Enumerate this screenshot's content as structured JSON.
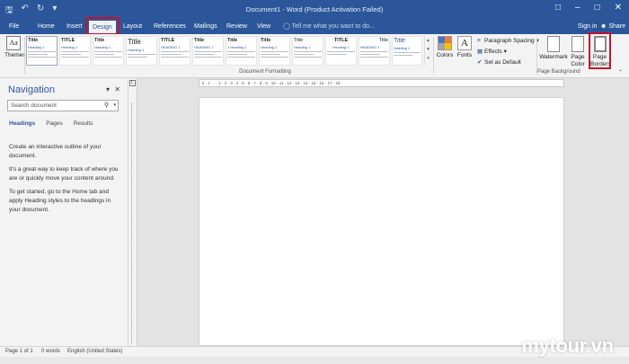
{
  "window": {
    "title": "Document1 - Word (Product Activation Failed)"
  },
  "quick_access": [
    "save-icon",
    "undo-icon",
    "redo-icon",
    "customize-icon"
  ],
  "tabs": [
    {
      "label": "File"
    },
    {
      "label": "Home"
    },
    {
      "label": "Insert"
    },
    {
      "label": "Design",
      "active": true
    },
    {
      "label": "Layout"
    },
    {
      "label": "References"
    },
    {
      "label": "Mailings"
    },
    {
      "label": "Review"
    },
    {
      "label": "View"
    }
  ],
  "tell_me": "Tell me what you want to do...",
  "account": {
    "sign_in": "Sign in",
    "share": "Share"
  },
  "ribbon": {
    "themes_label": "Themes",
    "style_gallery": [
      {
        "title": "Title",
        "heading": "Heading 1"
      },
      {
        "title": "TITLE",
        "heading": "Heading 1"
      },
      {
        "title": "Title",
        "heading": "Heading 1"
      },
      {
        "title": "Title",
        "heading": "Heading 1"
      },
      {
        "title": "TITLE",
        "heading": "HEADING 1"
      },
      {
        "title": "Title",
        "heading": "HEADING 1"
      },
      {
        "title": "Title",
        "heading": "1 Heading 1"
      },
      {
        "title": "Title",
        "heading": "Heading 1"
      },
      {
        "title": "Title",
        "heading": "Heading 1"
      },
      {
        "title": "TITLE",
        "heading": "Heading 1"
      },
      {
        "title": "Title",
        "heading": "HEADING 1"
      },
      {
        "title": "Title",
        "heading": "Heading 1"
      }
    ],
    "document_formatting_label": "Document Formatting",
    "colors_label": "Colors",
    "fonts_label": "Fonts",
    "paragraph_spacing_label": "Paragraph Spacing",
    "effects_label": "Effects",
    "set_default_label": "Set as Default",
    "watermark_label": "Watermark",
    "page_color_label": "Page Color",
    "page_borders_label": "Page Borders",
    "page_background_label": "Page Background"
  },
  "navigation": {
    "title": "Navigation",
    "search_placeholder": "Search document",
    "tabs": [
      "Headings",
      "Pages",
      "Results"
    ],
    "body": [
      "Create an interactive outline of your document.",
      "It's a great way to keep track of where you are or quickly move your content around.",
      "To get started, go to the Home tab and apply Heading styles to the headings in your document."
    ]
  },
  "ruler_text": "· 2 · 1 · · · 1 · 2 · 3 · 4 · 5 · 6 · 7 · 8 · 9 · 10 · 11 · 12 · 13 · 14 · 15 · 16 · 17 · 18 ·",
  "status": {
    "page": "Page 1 of 1",
    "words": "0 words",
    "language": "English (United States)"
  },
  "watermark_text": "mytour.vn",
  "colors": {
    "word_blue": "#2b579a",
    "highlight_red": "#c4122f"
  }
}
